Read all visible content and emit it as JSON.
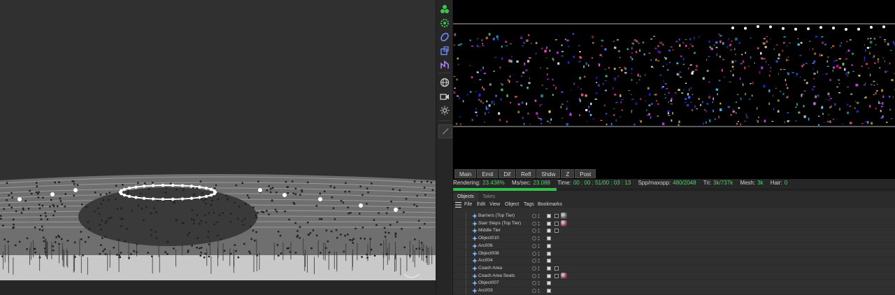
{
  "render_tabs": [
    "Main",
    "Emit",
    "Dif",
    "Refl",
    "Shdw",
    "Z",
    "Post"
  ],
  "render_stats": {
    "rendering_label": "Rendering:",
    "rendering_value": "23.438%",
    "ms_label": "Ms/sec:",
    "ms_value": "23.088",
    "time_label": "Time:",
    "time_value": "00 : 00 : 51/00 : 03 : 13",
    "spp_label": "Spp/maxspp:",
    "spp_value": "480/2048",
    "tri_label": "Tri:",
    "tri_value": "3k/737k",
    "mesh_label": "Mesh:",
    "mesh_value": "3k",
    "hair_label": "Hair:",
    "hair_value": "0",
    "progress_fraction": 0.234
  },
  "object_manager": {
    "tabs": [
      "Objects",
      "Takes"
    ],
    "menu": [
      "File",
      "Edit",
      "View",
      "Object",
      "Tags",
      "Bookmarks"
    ],
    "objects": [
      {
        "name": "Barriers (Top Tier)",
        "tags": 2,
        "material": "#4a4a4a"
      },
      {
        "name": "Stair Steps (Top Tier)",
        "tags": 2,
        "material": "#7a2a3a"
      },
      {
        "name": "Middle Tier",
        "tags": 2,
        "material": ""
      },
      {
        "name": "Object010",
        "tags": 1,
        "material": ""
      },
      {
        "name": "Arc006",
        "tags": 1,
        "material": ""
      },
      {
        "name": "Object008",
        "tags": 1,
        "material": ""
      },
      {
        "name": "Arc004",
        "tags": 1,
        "material": ""
      },
      {
        "name": "Coach Area",
        "tags": 2,
        "material": ""
      },
      {
        "name": "Coach Area Seats",
        "tags": 2,
        "material": "#6a2a3a"
      },
      {
        "name": "Object007",
        "tags": 1,
        "material": ""
      },
      {
        "name": "Arc003",
        "tags": 1,
        "material": ""
      }
    ]
  },
  "toolbar_icons": [
    "cloner-icon",
    "gear-effector-icon",
    "deformer-icon",
    "field-icon",
    "spline-icon",
    "globe-icon",
    "camera-icon",
    "light-icon",
    "brush-icon"
  ],
  "colors": {
    "accent_green": "#4fd46c",
    "progress": "#2fbf4a",
    "icon_green": "#3fc34f",
    "icon_blue": "#6f8cff",
    "icon_purple": "#b57fff"
  }
}
